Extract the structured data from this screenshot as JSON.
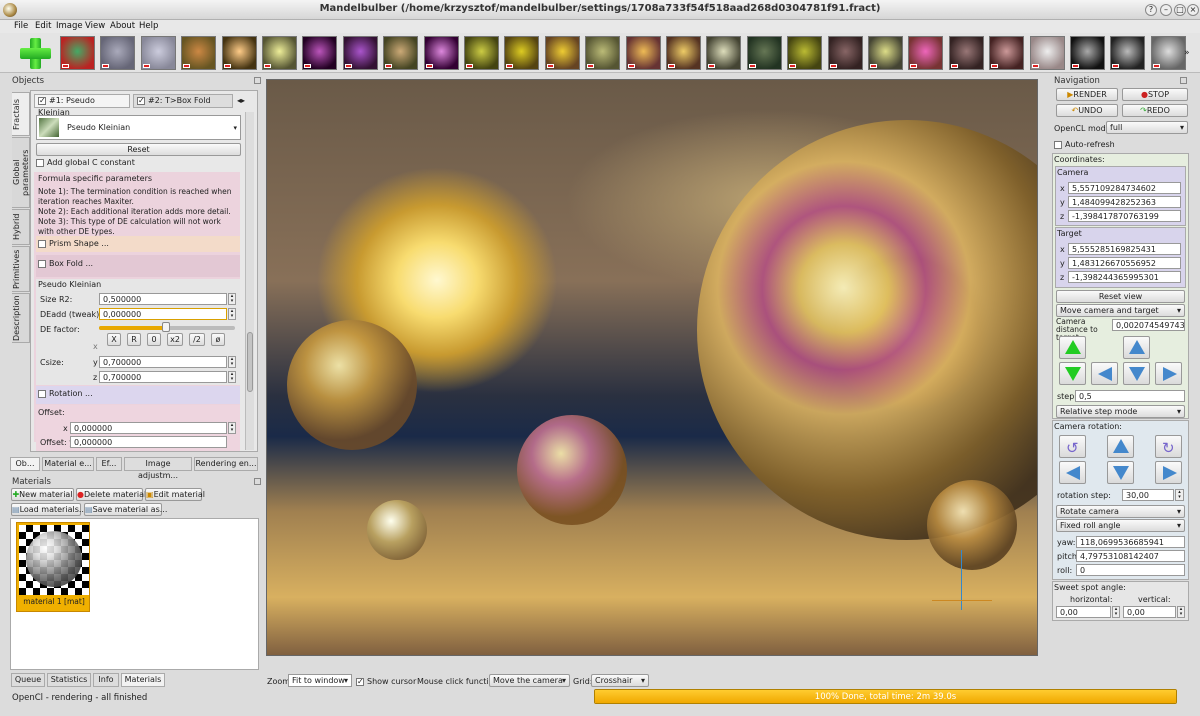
{
  "window": {
    "title": "Mandelbulber (/home/krzysztof/mandelbulber/settings/1708a733f54f518aad268d0304781f91.fract)"
  },
  "menu": [
    "File",
    "Edit",
    "Image",
    "View",
    "About",
    "Help"
  ],
  "thumbs": [
    [
      "#b22",
      "#4a6"
    ],
    [
      "#667",
      "#aab"
    ],
    [
      "#889",
      "#ccd"
    ],
    [
      "#652",
      "#c84"
    ],
    [
      "#431",
      "#fc8"
    ],
    [
      "#553",
      "#ee9"
    ],
    [
      "#202",
      "#b5b"
    ],
    [
      "#313",
      "#a5c"
    ],
    [
      "#442",
      "#ca7"
    ],
    [
      "#303",
      "#d8d"
    ],
    [
      "#441",
      "#cc4"
    ],
    [
      "#541",
      "#dc2"
    ],
    [
      "#642",
      "#ec3"
    ],
    [
      "#553",
      "#bb7"
    ],
    [
      "#633",
      "#eb5"
    ],
    [
      "#532",
      "#ec6"
    ],
    [
      "#443",
      "#ddb"
    ],
    [
      "#232",
      "#675"
    ],
    [
      "#441",
      "#bb3"
    ],
    [
      "#322",
      "#866"
    ],
    [
      "#443",
      "#dd8"
    ],
    [
      "#733",
      "#e6b"
    ],
    [
      "#322",
      "#977"
    ],
    [
      "#422",
      "#c99"
    ],
    [
      "#988",
      "#eee"
    ],
    [
      "#111",
      "#aaa"
    ],
    [
      "#222",
      "#bbb"
    ],
    [
      "#666",
      "#ddd"
    ]
  ],
  "objects": {
    "title": "Objects",
    "vtabs": [
      "Fractals",
      "Global parameters",
      "Hybrid",
      "Primitives",
      "Description"
    ],
    "formula_tabs": [
      "#1: Pseudo Kleinian",
      "#2: T>Box Fold"
    ],
    "formula_select": "Pseudo Kleinian",
    "reset_label": "Reset",
    "add_c_label": "Add global C constant",
    "formula_params_label": "Formula specific parameters",
    "notes": "Note 1): The termination condition is reached when iteration reaches Maxiter.\nNote 2): Each additional iteration adds more detail.\nNote 3): This type of DE calculation will not work with other DE types.",
    "prism_label": "Prism Shape ...",
    "boxfold_label": "Box Fold ...",
    "pk_label": "Pseudo Kleinian",
    "size_r2_label": "Size R2:",
    "size_r2": "0,500000",
    "deadd_label": "DEadd (tweak):",
    "deadd": "0,000000",
    "defactor_label": "DE factor:",
    "de_buttons": [
      "X",
      "R",
      "0",
      "x2",
      "/2",
      "ø"
    ],
    "csize_label": "Csize:",
    "y_label": "y",
    "z_label": "z",
    "x_label": "x",
    "csize_y": "0,700000",
    "csize_z": "0,700000",
    "rotation_label": "Rotation ...",
    "offset_label": "Offset:",
    "offset_x": "0,000000",
    "offset_y_label": "Offset: y",
    "offset_y": "0,000000"
  },
  "dock_tabs": [
    "Ob...",
    "Material e...",
    "Ef...",
    "Image adjustm...",
    "Rendering en..."
  ],
  "materials": {
    "title": "Materials",
    "buttons": [
      "New material",
      "Delete material",
      "Edit material",
      "Load materials...",
      "Save material as..."
    ],
    "item_label": "material 1 [mat]"
  },
  "bottom_tabs": [
    "Queue",
    "Statistics",
    "Info",
    "Materials"
  ],
  "status": {
    "text": "OpenCl - rendering - all finished",
    "progress_label": "100% Done, total time: 2m 39.0s",
    "progress": 1.0
  },
  "viewbar": {
    "zoom_label": "Zoom:",
    "zoom_value": "Fit to window",
    "show_cursor_label": "Show cursor",
    "mouse_label": "Mouse click function:",
    "mouse_value": "Move the camera",
    "grid_label": "Grid:",
    "grid_value": "Crosshair"
  },
  "nav": {
    "title": "Navigation",
    "render": "RENDER",
    "stop": "STOP",
    "undo": "UNDO",
    "redo": "REDO",
    "opencl_label": "OpenCL mode:",
    "opencl_value": "full",
    "autorefresh": "Auto-refresh",
    "coordinates": "Coordinates:",
    "camera_label": "Camera",
    "cam_x": "5,557109284734602",
    "cam_y": "1,484099428252363",
    "cam_z": "-1,398417870763199",
    "target_label": "Target",
    "tgt_x": "5,555285169825431",
    "tgt_y": "1,483126670556952",
    "tgt_z": "-1,398244365995301",
    "axis_x": "x",
    "axis_y": "y",
    "axis_z": "z",
    "reset_view": "Reset view",
    "move_mode": "Move camera and target",
    "cam_dist_label": "Camera distance to target:",
    "cam_dist": "0,002074549743986",
    "step_label": "step:",
    "step": "0,5",
    "step_mode": "Relative step mode",
    "rotation_title": "Camera rotation:",
    "rot_step_label": "rotation step:",
    "rot_step": "30,00",
    "rotate_mode": "Rotate camera",
    "angle_mode": "Fixed roll angle",
    "yaw_label": "yaw:",
    "yaw": "118,0699536685941",
    "pitch_label": "pitch:",
    "pitch": "4,79753108142407",
    "roll_label": "roll:",
    "roll": "0",
    "sweet_title": "Sweet spot angle:",
    "horizontal_label": "horizontal:",
    "vertical_label": "vertical:",
    "horizontal": "0,00",
    "vertical": "0,00"
  },
  "colors": {
    "accent": "#f2b600",
    "selection": "#f0b000"
  }
}
